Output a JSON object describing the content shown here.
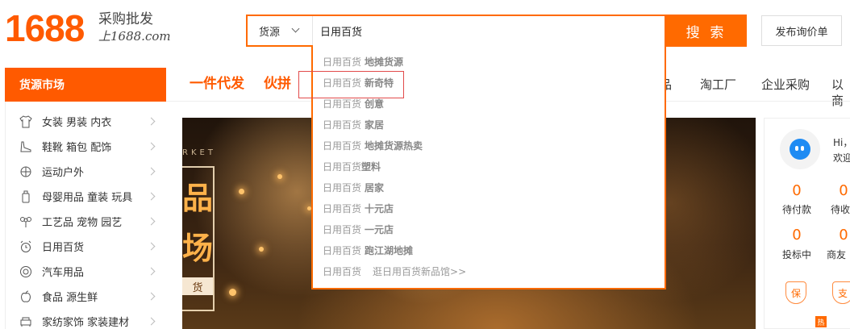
{
  "logo": {
    "number": "1688",
    "slogan": "采购批发",
    "domain": "上1688.com"
  },
  "search": {
    "category": "货源",
    "value": "日用百货",
    "button_label": "搜 索",
    "suggestions": [
      {
        "keyword": "日用百货",
        "extra": "地摊货源"
      },
      {
        "keyword": "日用百货",
        "extra": "新奇特"
      },
      {
        "keyword": "日用百货",
        "extra": "创意"
      },
      {
        "keyword": "日用百货",
        "extra": "家居"
      },
      {
        "keyword": "日用百货",
        "extra": "地摊货源热卖"
      },
      {
        "keyword": "日用百货",
        "extra": "塑料"
      },
      {
        "keyword": "日用百货",
        "extra": "居家"
      },
      {
        "keyword": "日用百货",
        "extra": "十元店"
      },
      {
        "keyword": "日用百货",
        "extra": "一元店"
      },
      {
        "keyword": "日用百货",
        "extra": "跑江湖地摊"
      }
    ],
    "more_keyword": "日用百货",
    "more_link": "逛日用百货新品馆>>"
  },
  "post_button": "发布询价单",
  "nav": {
    "category_header": "货源市场",
    "items": [
      "一件代发",
      "伙拼",
      "品",
      "淘工厂",
      "企业采购",
      "以商"
    ]
  },
  "categories": [
    {
      "icon": "shirt-icon",
      "label": "女装 男装 内衣"
    },
    {
      "icon": "shoe-icon",
      "label": "鞋靴 箱包 配饰"
    },
    {
      "icon": "sport-icon",
      "label": "运动户外"
    },
    {
      "icon": "baby-bottle-icon",
      "label": "母婴用品 童装 玩具"
    },
    {
      "icon": "flower-icon",
      "label": "工艺品 宠物 园艺"
    },
    {
      "icon": "alarm-clock-icon",
      "label": "日用百货"
    },
    {
      "icon": "tire-icon",
      "label": "汽车用品"
    },
    {
      "icon": "apple-icon",
      "label": "食品 源生鲜"
    },
    {
      "icon": "sofa-icon",
      "label": "家纺家饰 家装建材"
    }
  ],
  "banner": {
    "market_text": "RKET",
    "chars": [
      "品",
      "场"
    ],
    "tag": "货"
  },
  "user_panel": {
    "greeting": "Hi，",
    "welcome": "欢迎",
    "stats": [
      {
        "value": "0",
        "label": "待付款"
      },
      {
        "value": "0",
        "label": "待收"
      },
      {
        "value": "0",
        "label": "投标中"
      },
      {
        "value": "0",
        "label": "商友"
      }
    ],
    "badges": [
      "保",
      "支"
    ],
    "hot": "热"
  },
  "colors": {
    "accent": "#ff6a00",
    "highlight_box": "#e24b4b"
  }
}
